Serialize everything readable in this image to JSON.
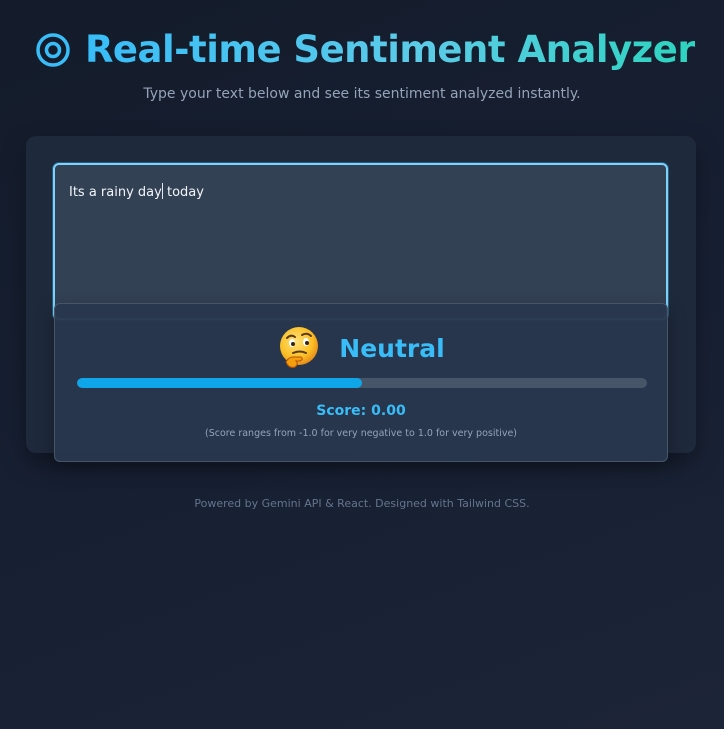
{
  "header": {
    "icon": "target-icon",
    "title": "Real-time Sentiment Analyzer",
    "subtitle": "Type your text below and see its sentiment analyzed instantly."
  },
  "input": {
    "value_before_cursor": "Its a rainy day",
    "value_after_cursor": " today"
  },
  "result": {
    "emoji": "thinking-face-icon",
    "label": "Neutral",
    "bar_fill_percent": 50,
    "score_text": "Score: 0.00",
    "note": "(Score ranges from -1.0 for very negative to 1.0 for very positive)"
  },
  "footer": {
    "text": "Powered by Gemini API & React. Designed with Tailwind CSS."
  },
  "colors": {
    "accent": "#38bdf8",
    "accent_teal": "#2dd4bf",
    "bar_fill": "#0ea5e9",
    "bar_track": "#475569",
    "card_bg": "#1e293b",
    "input_bg": "#334155",
    "page_bg": "#172033"
  }
}
